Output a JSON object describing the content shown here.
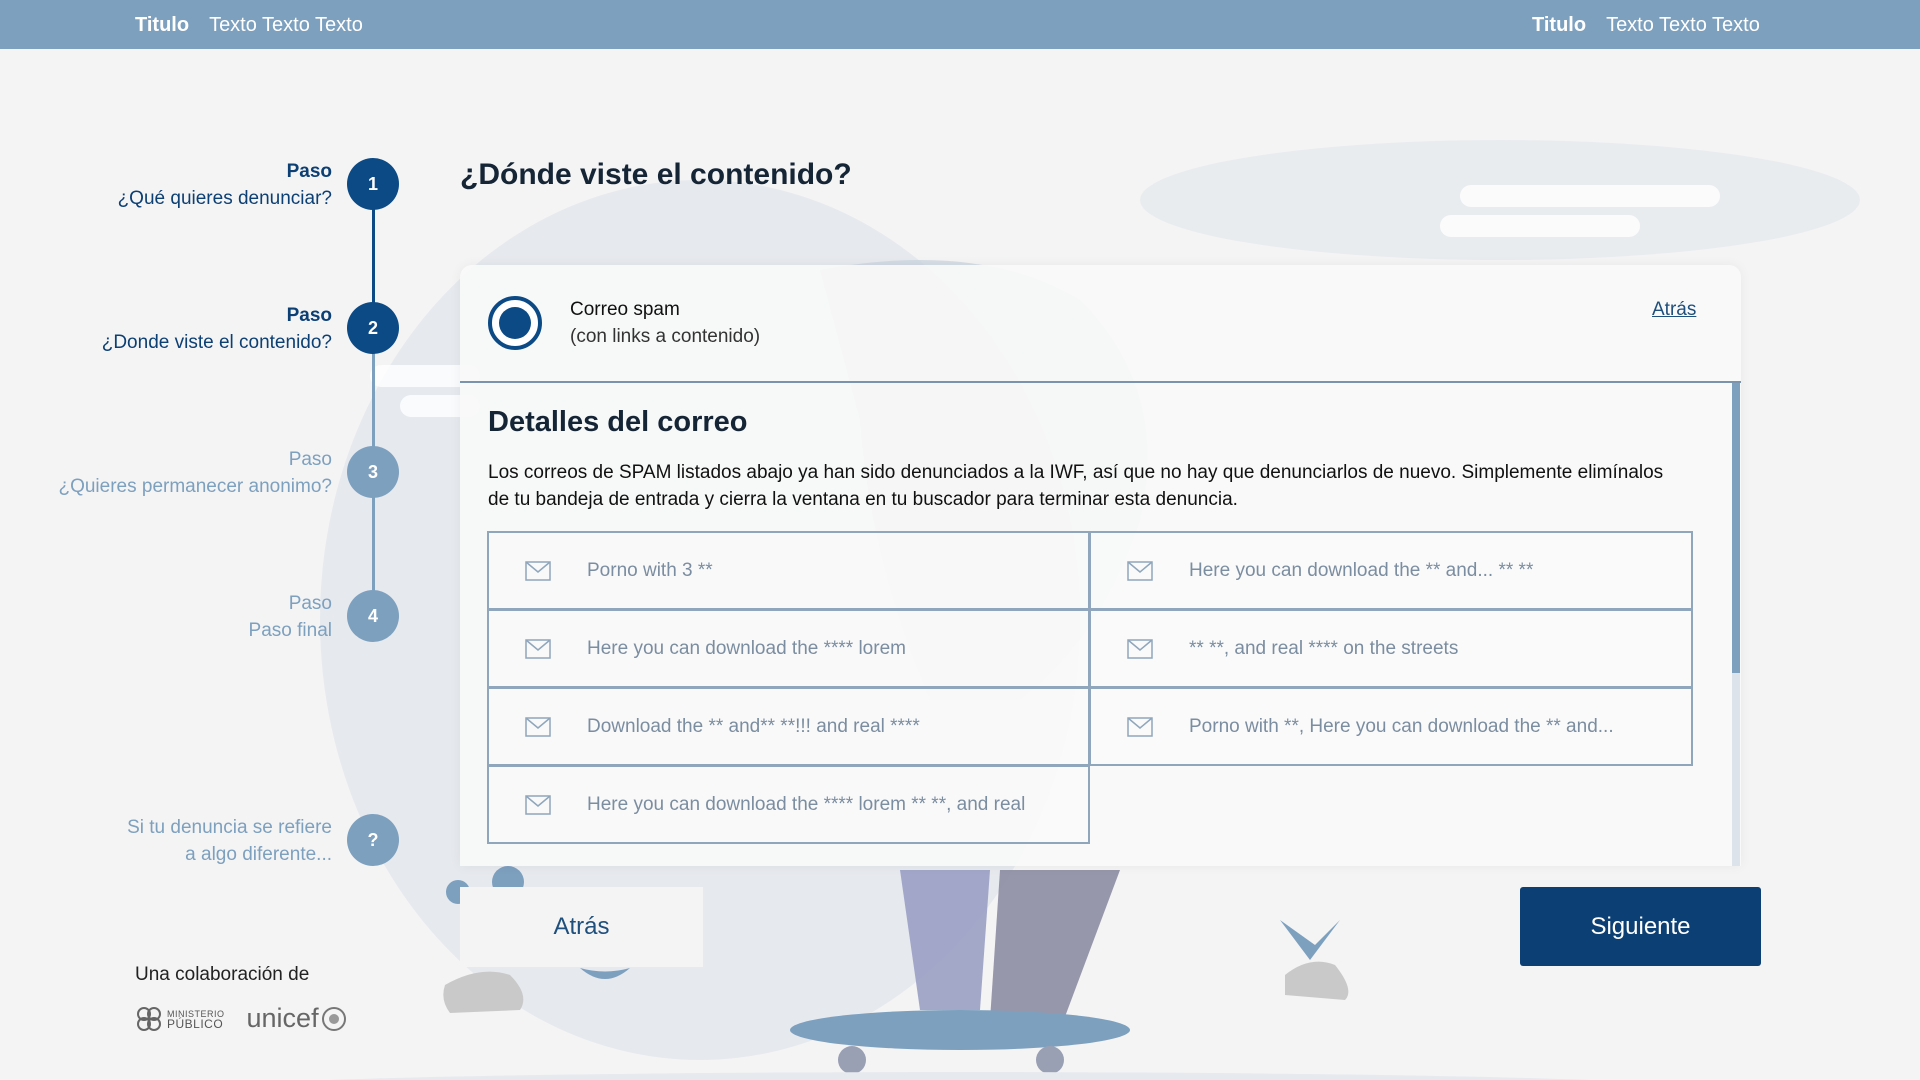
{
  "topbar": {
    "left": {
      "title": "Titulo",
      "text": "Texto Texto Texto"
    },
    "right": {
      "title": "Titulo",
      "text": "Texto Texto Texto"
    }
  },
  "stepper": {
    "steps": [
      {
        "label": "Paso",
        "title": "¿Qué quieres denunciar?",
        "number": "1"
      },
      {
        "label": "Paso",
        "title": "¿Donde viste el contenido?",
        "number": "2"
      },
      {
        "label": "Paso",
        "title": "¿Quieres permanecer anonimo?",
        "number": "3"
      },
      {
        "label": "Paso",
        "title": "Paso final",
        "number": "4"
      }
    ],
    "other": {
      "line1": "Si tu denuncia se refiere",
      "line2": "a algo diferente...",
      "symbol": "?"
    }
  },
  "page": {
    "title": "¿Dónde viste el contenido?"
  },
  "card": {
    "option_title": "Correo spam",
    "option_sub": "(con links a contenido)",
    "back_link": "Atrás",
    "details_title": "Detalles del correo",
    "details_text": "Los correos de SPAM listados abajo ya han sido denunciados a la IWF, así que no hay que denunciarlos de nuevo. Simplemente elimínalos de tu bandeja de entrada y cierra la ventana en tu buscador para terminar esta denuncia.",
    "emails": [
      "Porno with 3 **",
      "Here you can download the ** and... ** **",
      "Here you can download the **** lorem",
      "** **, and real **** on the streets",
      "Download the ** and** **!!! and real ****",
      "Porno with **, Here you can download the ** and...",
      "Here you can download the **** lorem ** **, and real"
    ]
  },
  "buttons": {
    "back": "Atrás",
    "next": "Siguiente"
  },
  "footer": {
    "collab": "Una colaboración de",
    "logo_mp_line1": "MINISTERIO",
    "logo_mp_line2": "PÚBLICO",
    "logo_unicef": "unicef"
  },
  "colors": {
    "topbar": "#7da0bf",
    "primary": "#0c4a85",
    "button": "#0c3f74",
    "inactive": "#7da0bf"
  }
}
